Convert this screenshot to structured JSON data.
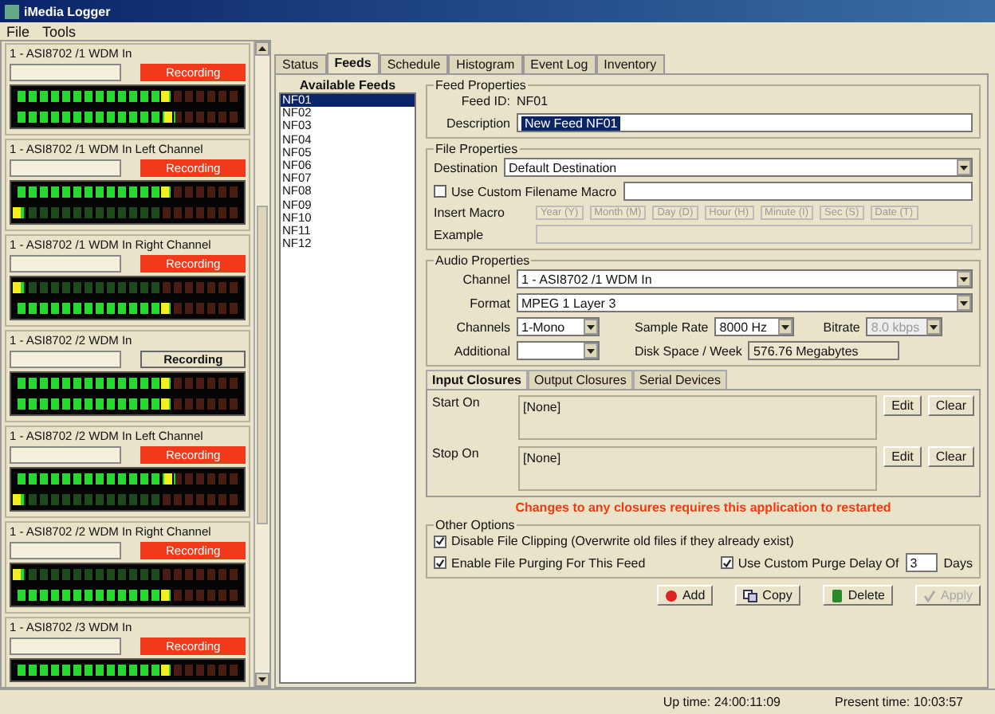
{
  "window": {
    "title": "iMedia Logger"
  },
  "menu": [
    "File",
    "Tools"
  ],
  "channels": [
    {
      "name": "1 - ASI8702 /1 WDM In",
      "status": "Recording",
      "recording": true,
      "meters": [
        {
          "level": 0.7
        },
        {
          "level": 0.72
        }
      ]
    },
    {
      "name": "1 - ASI8702 /1 WDM In Left Channel",
      "status": "Recording",
      "recording": true,
      "meters": [
        {
          "level": 0.7
        },
        {
          "level": 0.03
        }
      ]
    },
    {
      "name": "1 - ASI8702 /1 WDM In Right Channel",
      "status": "Recording",
      "recording": true,
      "meters": [
        {
          "level": 0.03
        },
        {
          "level": 0.7
        }
      ]
    },
    {
      "name": "1 - ASI8702 /2 WDM In",
      "status": "Recording",
      "recording": false,
      "meters": [
        {
          "level": 0.7
        },
        {
          "level": 0.7
        }
      ]
    },
    {
      "name": "1 - ASI8702 /2 WDM In Left Channel",
      "status": "Recording",
      "recording": true,
      "meters": [
        {
          "level": 0.72
        },
        {
          "level": 0.03
        }
      ]
    },
    {
      "name": "1 - ASI8702 /2 WDM In Right Channel",
      "status": "Recording",
      "recording": true,
      "meters": [
        {
          "level": 0.03
        },
        {
          "level": 0.7
        }
      ]
    },
    {
      "name": "1 - ASI8702 /3 WDM In",
      "status": "Recording",
      "recording": true,
      "meters": [
        {
          "level": 0.7
        }
      ]
    }
  ],
  "tabs": [
    {
      "label": "Status",
      "selected": false
    },
    {
      "label": "Feeds",
      "selected": true
    },
    {
      "label": "Schedule",
      "selected": false
    },
    {
      "label": "Histogram",
      "selected": false
    },
    {
      "label": "Event Log",
      "selected": false
    },
    {
      "label": "Inventory",
      "selected": false
    }
  ],
  "feeds": {
    "title": "Available Feeds",
    "items": [
      {
        "label": "NF01",
        "selected": true
      },
      {
        "label": "NF02",
        "selected": false
      },
      {
        "label": "NF03",
        "selected": false
      },
      {
        "label": "NF04",
        "selected": false
      },
      {
        "label": "NF05",
        "selected": false
      },
      {
        "label": "NF06",
        "selected": false
      },
      {
        "label": "NF07",
        "selected": false
      },
      {
        "label": "NF08",
        "selected": false
      },
      {
        "label": "NF09",
        "selected": false
      },
      {
        "label": "NF10",
        "selected": false
      },
      {
        "label": "NF11",
        "selected": false
      },
      {
        "label": "NF12",
        "selected": false
      }
    ]
  },
  "feed_properties": {
    "title": "Feed Properties",
    "feed_id_label": "Feed ID:",
    "feed_id": "NF01",
    "description_label": "Description",
    "description": "New Feed NF01"
  },
  "file_properties": {
    "title": "File Properties",
    "destination_label": "Destination",
    "destination": "Default Destination",
    "custom_macro": {
      "label": "Use Custom Filename Macro",
      "checked": false
    },
    "insert_macro_label": "Insert Macro",
    "macros": [
      "Year (Y)",
      "Month (M)",
      "Day (D)",
      "Hour (H)",
      "Minute (I)",
      "Sec (S)",
      "Date (T)"
    ],
    "example_label": "Example"
  },
  "audio_properties": {
    "title": "Audio Properties",
    "channel_label": "Channel",
    "channel": "1 - ASI8702 /1 WDM In",
    "format_label": "Format",
    "format": "MPEG 1 Layer 3",
    "channels_label": "Channels",
    "channels": "1-Mono",
    "sample_rate_label": "Sample Rate",
    "sample_rate": "8000 Hz",
    "bitrate_label": "Bitrate",
    "bitrate": "8.0 kbps",
    "additional_label": "Additional",
    "disk_label": "Disk Space / Week",
    "disk": "576.76 Megabytes"
  },
  "closure_tabs": [
    {
      "label": "Input Closures",
      "selected": true
    },
    {
      "label": "Output Closures",
      "selected": false
    },
    {
      "label": "Serial Devices",
      "selected": false
    }
  ],
  "closures": [
    {
      "label": "Start On",
      "value": "[None]",
      "edit": "Edit",
      "clear": "Clear"
    },
    {
      "label": "Stop On",
      "value": "[None]",
      "edit": "Edit",
      "clear": "Clear"
    }
  ],
  "warning": "Changes to any closures requires this application to restarted",
  "other_options": {
    "title": "Other Options",
    "clipping": {
      "label": "Disable File Clipping (Overwrite old files if they already exist)",
      "checked": true
    },
    "purging": {
      "label": "Enable File Purging For This Feed",
      "checked": true
    },
    "purge_delay": {
      "label": "Use Custom Purge Delay Of",
      "checked": true
    },
    "delay": "3",
    "days": "Days"
  },
  "buttons": [
    {
      "label": "Add",
      "kind": "add",
      "disabled": false
    },
    {
      "label": "Copy",
      "kind": "copy",
      "disabled": false
    },
    {
      "label": "Delete",
      "kind": "delete",
      "disabled": false
    },
    {
      "label": "Apply",
      "kind": "apply",
      "disabled": true
    }
  ],
  "status_bar": {
    "up_time": "Up time: 24:00:11:09",
    "present_time": "Present time: 10:03:57"
  }
}
